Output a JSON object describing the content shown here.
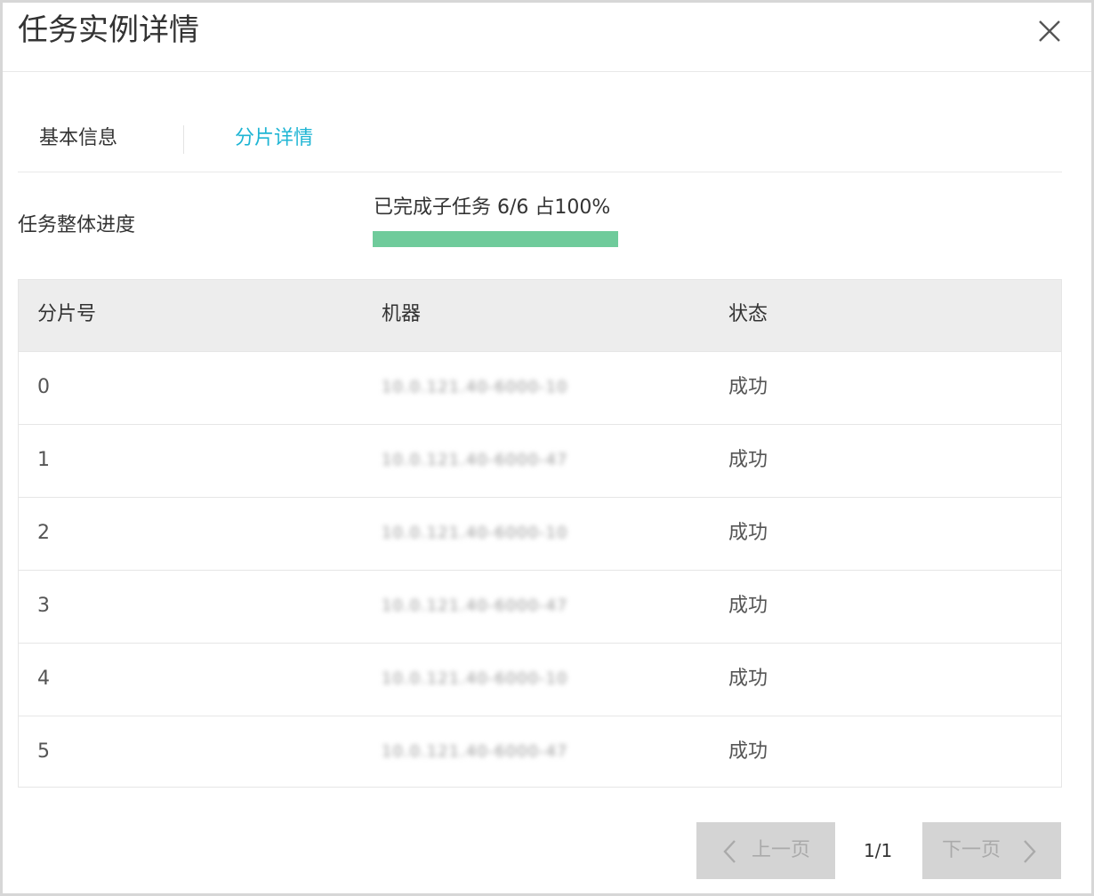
{
  "dialog": {
    "title": "任务实例详情",
    "close_icon": "close-icon"
  },
  "tabs": [
    {
      "label": "基本信息",
      "active": false
    },
    {
      "label": "分片详情",
      "active": true
    }
  ],
  "accent_color": "#1fb5d4",
  "progress": {
    "label": "任务整体进度",
    "text": "已完成子任务 6/6 占100%",
    "completed": 6,
    "total": 6,
    "percent": 100,
    "bar_color": "#6fcb9b"
  },
  "table": {
    "columns": [
      "分片号",
      "机器",
      "状态"
    ],
    "rows": [
      {
        "shard": "0",
        "machine": "10.0.121.40-6000-10",
        "status": "成功"
      },
      {
        "shard": "1",
        "machine": "10.0.121.40-6000-47",
        "status": "成功"
      },
      {
        "shard": "2",
        "machine": "10.0.121.40-6000-10",
        "status": "成功"
      },
      {
        "shard": "3",
        "machine": "10.0.121.40-6000-47",
        "status": "成功"
      },
      {
        "shard": "4",
        "machine": "10.0.121.40-6000-10",
        "status": "成功"
      },
      {
        "shard": "5",
        "machine": "10.0.121.40-6000-47",
        "status": "成功"
      }
    ]
  },
  "pager": {
    "prev_label": "上一页",
    "next_label": "下一页",
    "page": "1/1",
    "prev_icon": "chevron-left-icon",
    "next_icon": "chevron-right-icon"
  }
}
